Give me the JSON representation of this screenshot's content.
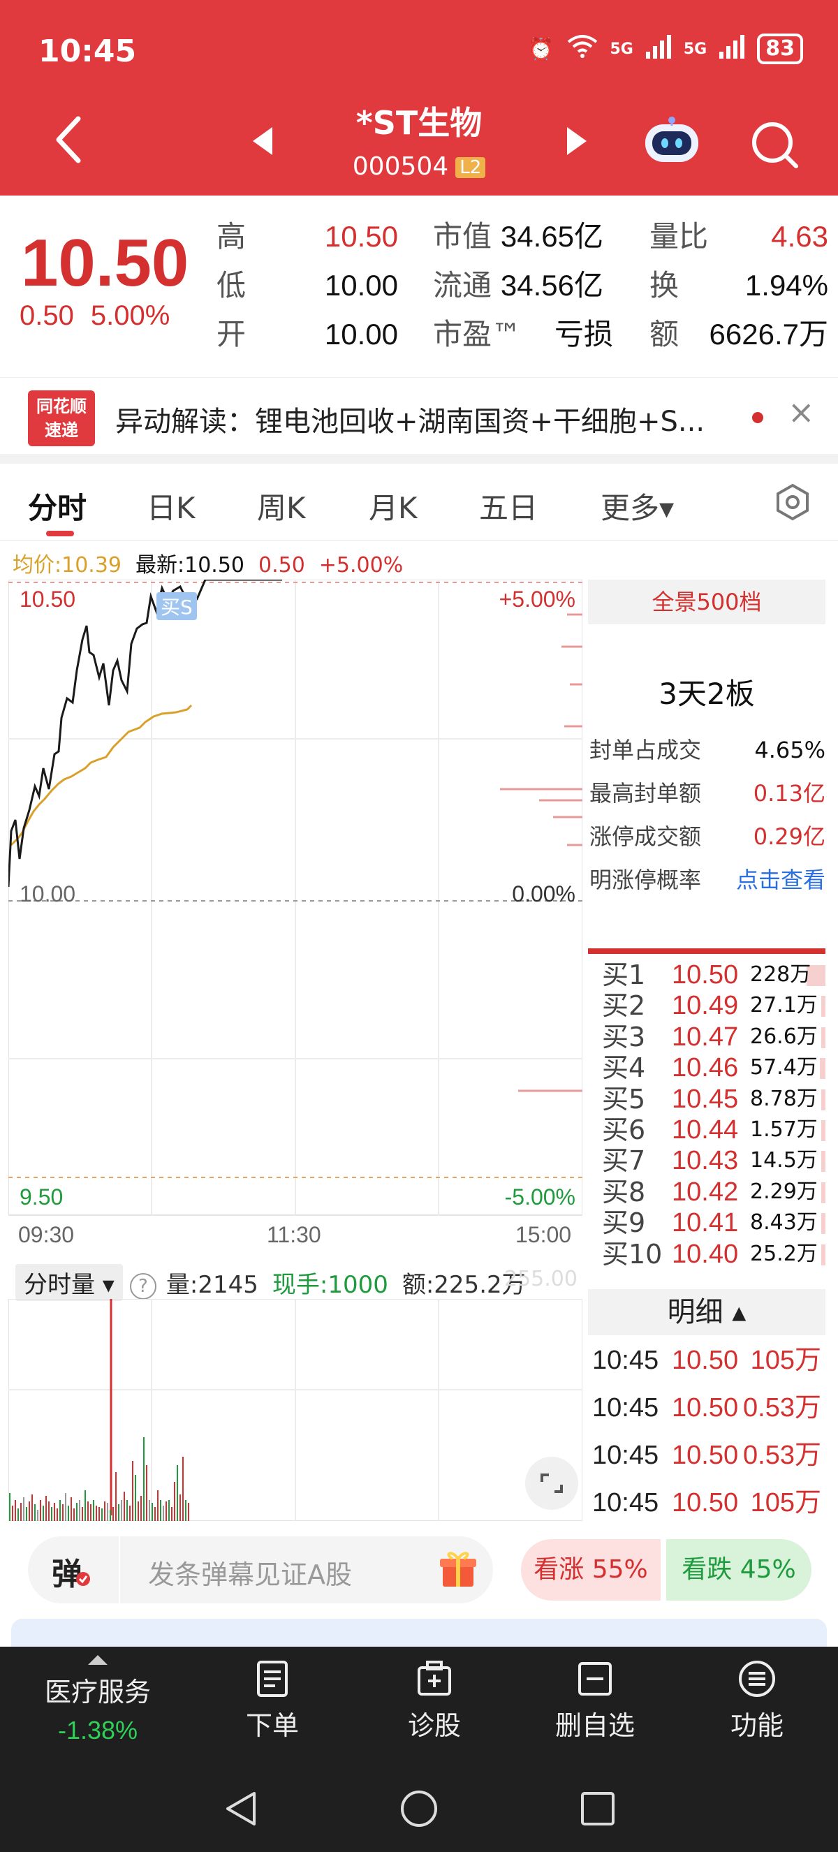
{
  "status_bar": {
    "time": "10:45",
    "net1": "5G",
    "net2": "5G",
    "battery": "83"
  },
  "header": {
    "stock_name": "*ST生物",
    "stock_code": "000504",
    "level_badge": "L2"
  },
  "quote": {
    "price": "10.50",
    "change": "0.50",
    "change_pct": "5.00%",
    "rows": [
      {
        "l1": "高",
        "v1": "10.50",
        "l2": "市值",
        "v2": "34.65亿",
        "l3": "量比",
        "v3": "4.63"
      },
      {
        "l1": "低",
        "v1": "10.00",
        "l2": "流通",
        "v2": "34.56亿",
        "l3": "换",
        "v3": "1.94%"
      },
      {
        "l1": "开",
        "v1": "10.00",
        "l2": "市盈™",
        "v2": "亏损",
        "l3": "额",
        "v3": "6626.7万"
      }
    ]
  },
  "news": {
    "logo_line1": "同花顺",
    "logo_line2": "速递",
    "text": "异动解读：锂电池回收+湖南国资+干细胞+S...",
    "close": "×"
  },
  "tabs": [
    "分时",
    "日K",
    "周K",
    "月K",
    "五日",
    "更多▾"
  ],
  "intraday": {
    "avg_label": "均价:10.39",
    "latest_label": "最新:10.50",
    "latest_change": "0.50",
    "latest_pct": "+5.00%",
    "price_top": "10.50",
    "price_mid": "10.00",
    "price_bottom": "9.50",
    "pct_top": "+5.00%",
    "pct_mid": "0.00%",
    "pct_bottom": "-5.00%",
    "time_start": "09:30",
    "time_mid": "11:30",
    "time_end": "15:00",
    "marker": "买S"
  },
  "right_panel": {
    "depth_tag": "全景500档",
    "board": "3天2板",
    "stats": [
      {
        "label": "封单占成交",
        "value": "4.65%",
        "color": "dark"
      },
      {
        "label": "最高封单额",
        "value": "0.13亿",
        "color": "red"
      },
      {
        "label": "涨停成交额",
        "value": "0.29亿",
        "color": "red"
      },
      {
        "label": "明涨停概率",
        "value": "点击查看",
        "color": "blue"
      }
    ],
    "order_book": [
      {
        "label": "买1",
        "price": "10.50",
        "vol": "228万",
        "bar": 0.9
      },
      {
        "label": "买2",
        "price": "10.49",
        "vol": "27.1万",
        "bar": 0.12
      },
      {
        "label": "买3",
        "price": "10.47",
        "vol": "26.6万",
        "bar": 0.12
      },
      {
        "label": "买4",
        "price": "10.46",
        "vol": "57.4万",
        "bar": 0.25
      },
      {
        "label": "买5",
        "price": "10.45",
        "vol": "8.78万",
        "bar": 0.04
      },
      {
        "label": "买6",
        "price": "10.44",
        "vol": "1.57万",
        "bar": 0.02
      },
      {
        "label": "买7",
        "price": "10.43",
        "vol": "14.5万",
        "bar": 0.07
      },
      {
        "label": "买8",
        "price": "10.42",
        "vol": "2.29万",
        "bar": 0.02
      },
      {
        "label": "买9",
        "price": "10.41",
        "vol": "8.43万",
        "bar": 0.04
      },
      {
        "label": "买10",
        "price": "10.40",
        "vol": "25.2万",
        "bar": 0.11
      }
    ],
    "detail_title": "明细 ▴",
    "details": [
      {
        "time": "10:45",
        "price": "10.50",
        "vol": "105万"
      },
      {
        "time": "10:45",
        "price": "10.50",
        "vol": "0.53万"
      },
      {
        "time": "10:45",
        "price": "10.50",
        "vol": "0.53万"
      },
      {
        "time": "10:45",
        "price": "10.50",
        "vol": "105万"
      }
    ]
  },
  "volume": {
    "selector": "分时量",
    "help": "?",
    "qty_label": "量:2145",
    "now_label": "现手:1000",
    "amt_label": "额:225.2万",
    "corner_label": "255.00"
  },
  "barrage": {
    "icon": "弹",
    "placeholder": "发条弹幕见证A股"
  },
  "vote": {
    "up": "看涨 55%",
    "down": "看跌 45%"
  },
  "toolbar": {
    "sector_name": "医疗服务",
    "sector_change": "-1.38%",
    "items": [
      "下单",
      "诊股",
      "删自选",
      "功能"
    ]
  },
  "colors": {
    "brand_red": "#e03a3e",
    "up_red": "#d4302f",
    "down_green": "#1f9b3d",
    "avg_line": "#d9a12a"
  }
}
